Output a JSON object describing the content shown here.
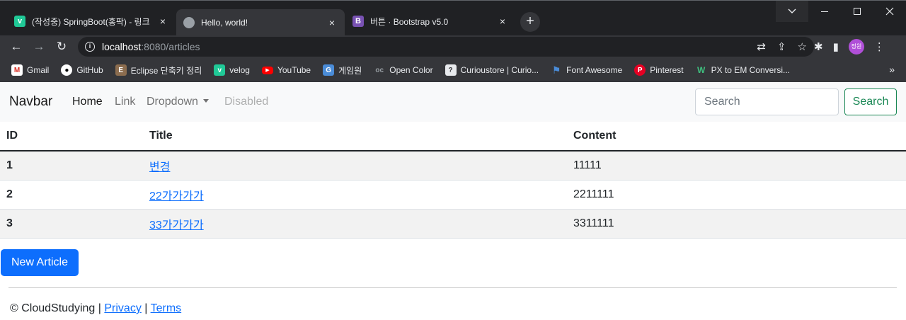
{
  "browser": {
    "tabs": [
      {
        "title": "(작성중) SpringBoot(홍팍) - 링크",
        "favicon": "velog-icon",
        "close": "×"
      },
      {
        "title": "Hello, world!",
        "favicon": "globe-icon",
        "close": "×"
      },
      {
        "title": "버튼 · Bootstrap v5.0",
        "favicon": "bootstrap-icon",
        "close": "×"
      }
    ],
    "new_tab": "+",
    "url_host": "localhost",
    "url_path": ":8080/articles",
    "avatar_text": "정원",
    "bookmarks": [
      {
        "label": "Gmail",
        "icon": "gmail-icon",
        "glyph": "M"
      },
      {
        "label": "GitHub",
        "icon": "github-icon",
        "glyph": "●"
      },
      {
        "label": "Eclipse 단축키 정리",
        "icon": "eclipse-icon",
        "glyph": "E"
      },
      {
        "label": "velog",
        "icon": "velog-icon",
        "glyph": "v"
      },
      {
        "label": "YouTube",
        "icon": "youtube-icon",
        "glyph": "▶"
      },
      {
        "label": "게임원",
        "icon": "game-icon",
        "glyph": "G"
      },
      {
        "label": "Open Color",
        "icon": "open-color-icon",
        "glyph": "oc"
      },
      {
        "label": "Curioustore | Curio...",
        "icon": "curio-icon",
        "glyph": "?"
      },
      {
        "label": "Font Awesome",
        "icon": "flag-icon",
        "glyph": "⚑"
      },
      {
        "label": "Pinterest",
        "icon": "pinterest-icon",
        "glyph": "P"
      },
      {
        "label": "PX to EM Conversi...",
        "icon": "px-icon",
        "glyph": "W"
      }
    ],
    "bookmarks_more": "»"
  },
  "navbar": {
    "brand": "Navbar",
    "links": {
      "home": "Home",
      "link": "Link",
      "dropdown": "Dropdown",
      "disabled": "Disabled"
    },
    "search_placeholder": "Search",
    "search_button": "Search"
  },
  "table": {
    "headers": {
      "id": "ID",
      "title": "Title",
      "content": "Content"
    },
    "rows": [
      {
        "id": "1",
        "title": "변경",
        "content": "11111"
      },
      {
        "id": "2",
        "title": "22가가가가",
        "content": "2211111"
      },
      {
        "id": "3",
        "title": "33가가가가",
        "content": "3311111"
      }
    ]
  },
  "new_article_button": "New Article",
  "footer": {
    "copyright": "© CloudStudying",
    "sep1": "|",
    "privacy": "Privacy",
    "sep2": "|",
    "terms": "Terms"
  },
  "colors": {
    "primary": "#0d6efd",
    "success": "#198754",
    "navbar_bg": "#f8f9fa",
    "chrome_dark": "#202124",
    "chrome_toolbar": "#35363a"
  }
}
